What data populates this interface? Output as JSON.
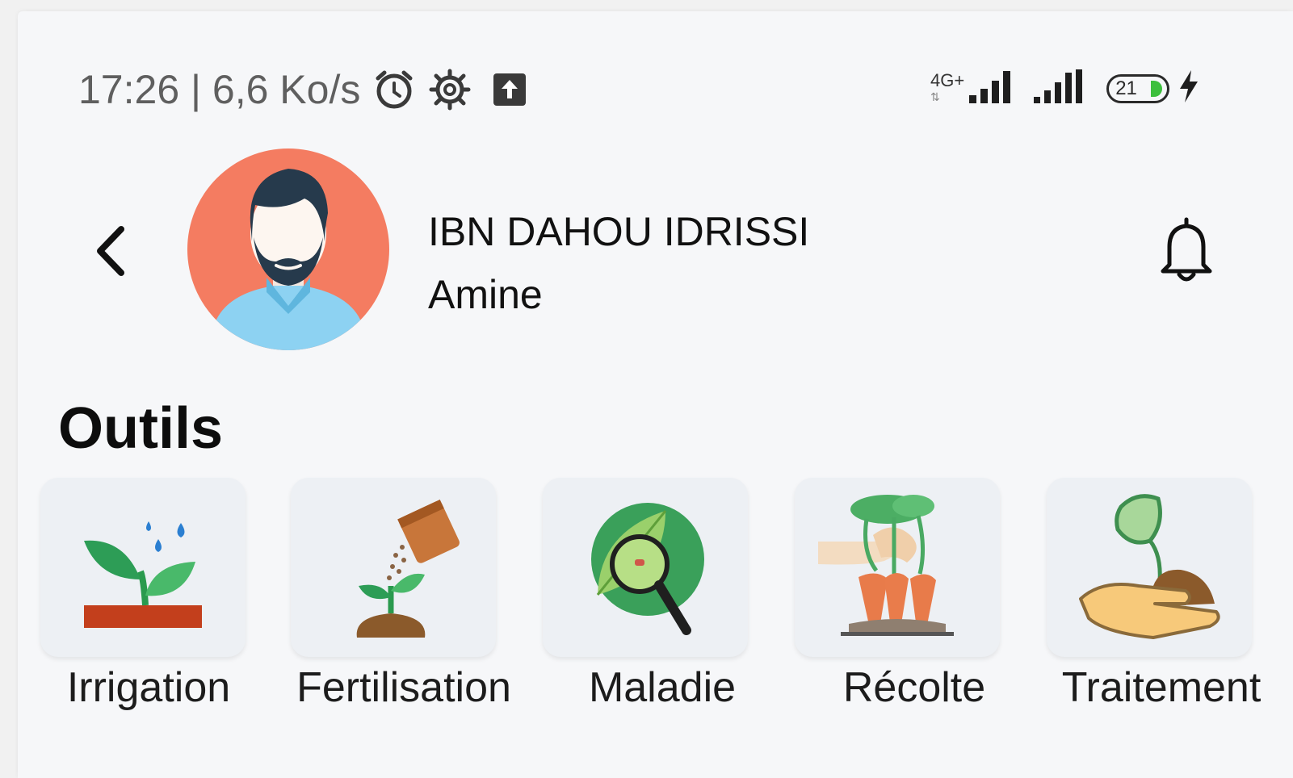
{
  "status_bar": {
    "text": "17:26 | 6,6 Ko/s",
    "network": "4G+",
    "battery": "21",
    "icons": [
      "alarm-icon",
      "settings-gear-icon",
      "upload-icon",
      "signal-icon",
      "signal-icon",
      "battery-icon",
      "charging-icon"
    ]
  },
  "header": {
    "last_name": "IBN DAHOU IDRISSI",
    "first_name": "Amine",
    "icons": [
      "back-arrow-icon",
      "bell-icon"
    ]
  },
  "tools": {
    "title": "Outils",
    "items": [
      {
        "label": "Irrigation",
        "icon": "irrigation-plant-icon"
      },
      {
        "label": "Fertilisation",
        "icon": "fertilisation-bag-icon"
      },
      {
        "label": "Maladie",
        "icon": "leaf-magnifier-icon"
      },
      {
        "label": "Récolte",
        "icon": "carrot-harvest-icon"
      },
      {
        "label": "Traitement",
        "icon": "hand-sprout-icon"
      }
    ]
  },
  "colors": {
    "avatar_bg": "#f47c61",
    "card_bg": "#edf0f4",
    "leaf_green": "#3daa60",
    "battery_fill": "#3dbf3d"
  }
}
